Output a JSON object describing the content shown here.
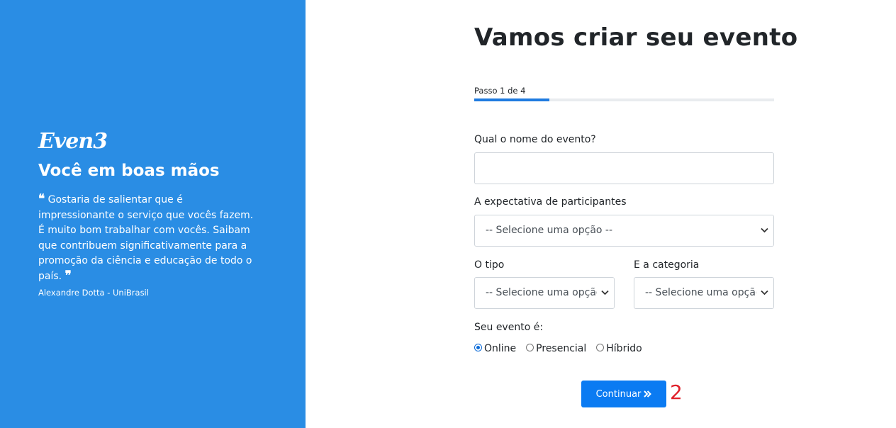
{
  "brand": {
    "logo_text": "Even3",
    "tagline": "Você em boas mãos",
    "quote_open": "❝",
    "quote_text": "Gostaria de salientar que é impressionante o serviço que vocês fazem. É muito bom trabalhar com vocês. Saibam que contribuem significativamente para a promoção da ciência e educação de todo o país.",
    "quote_close": "❞",
    "quote_author": "Alexandre Dotta - UniBrasil",
    "panel_color": "#2a8de4"
  },
  "form": {
    "title": "Vamos criar seu evento",
    "step_label": "Passo 1 de 4",
    "progress_fraction": 0.25,
    "event_name_label": "Qual o nome do evento?",
    "event_name_value": "",
    "attendance_label": "A expectativa de participantes",
    "attendance_selected": "-- Selecione uma opção --",
    "type_label": "O tipo",
    "type_selected": "-- Selecione uma opção --",
    "category_label": "E a categoria",
    "category_selected": "-- Selecione uma opção --",
    "format_label": "Seu evento é:",
    "format_options": [
      {
        "label": "Online",
        "checked": true
      },
      {
        "label": "Presencial",
        "checked": false
      },
      {
        "label": "Híbrido",
        "checked": false
      }
    ],
    "continue_label": "Continuar",
    "continue_icon": "double-chevron-right-icon",
    "accent_color": "#0b7bf2"
  },
  "annotation": {
    "step_marker": "2",
    "marker_color": "#e0202a"
  }
}
